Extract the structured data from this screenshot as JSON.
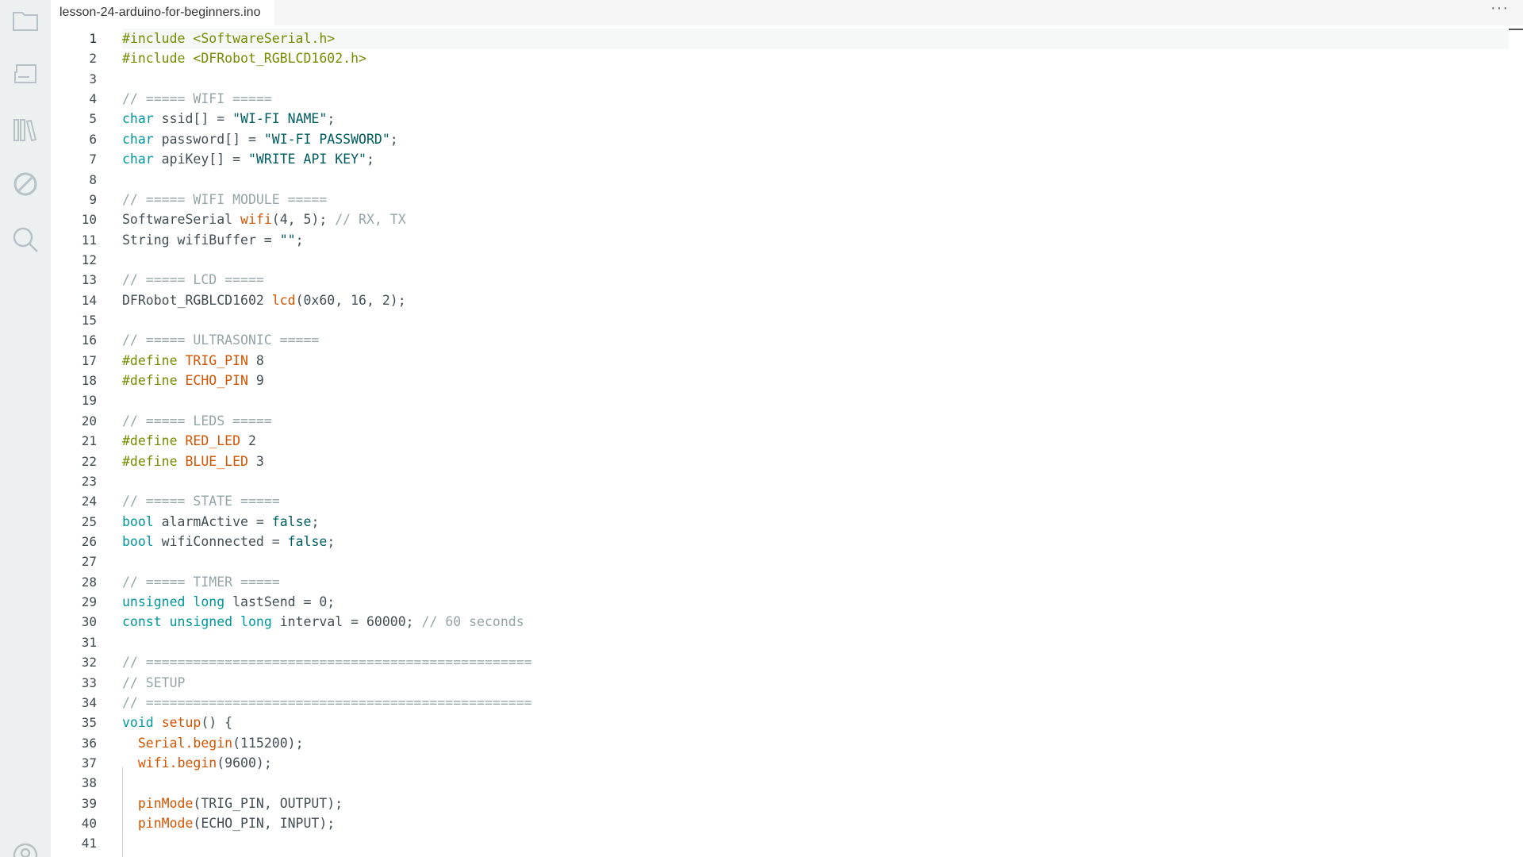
{
  "tab": {
    "filename": "lesson-24-arduino-for-beginners.ino",
    "more_label": "···"
  },
  "sidebar": {
    "icons": [
      "folder-icon",
      "board-icon",
      "library-icon",
      "debug-icon",
      "search-icon",
      "account-icon"
    ]
  },
  "editor": {
    "current_line": 1,
    "lines": [
      [
        [
          "pp",
          "#include <SoftwareSerial.h>"
        ]
      ],
      [
        [
          "pp",
          "#include <DFRobot_RGBLCD1602.h>"
        ]
      ],
      [],
      [
        [
          "com",
          "// ===== WIFI ====="
        ]
      ],
      [
        [
          "kw",
          "char"
        ],
        [
          "id",
          " ssid[] = "
        ],
        [
          "str",
          "\"WI-FI NAME\""
        ],
        [
          "id",
          ";"
        ]
      ],
      [
        [
          "kw",
          "char"
        ],
        [
          "id",
          " password[] = "
        ],
        [
          "str",
          "\"WI-FI PASSWORD\""
        ],
        [
          "id",
          ";"
        ]
      ],
      [
        [
          "kw",
          "char"
        ],
        [
          "id",
          " apiKey[] = "
        ],
        [
          "str",
          "\"WRITE API KEY\""
        ],
        [
          "id",
          ";"
        ]
      ],
      [],
      [
        [
          "com",
          "// ===== WIFI MODULE ====="
        ]
      ],
      [
        [
          "id",
          "SoftwareSerial "
        ],
        [
          "fn",
          "wifi"
        ],
        [
          "id",
          "(4, 5); "
        ],
        [
          "com",
          "// RX, TX"
        ]
      ],
      [
        [
          "id",
          "String wifiBuffer = "
        ],
        [
          "str",
          "\"\""
        ],
        [
          "id",
          ";"
        ]
      ],
      [],
      [
        [
          "com",
          "// ===== LCD ====="
        ]
      ],
      [
        [
          "id",
          "DFRobot_RGBLCD1602 "
        ],
        [
          "fn",
          "lcd"
        ],
        [
          "id",
          "(0x60, 16, 2);"
        ]
      ],
      [],
      [
        [
          "com",
          "// ===== ULTRASONIC ====="
        ]
      ],
      [
        [
          "pp",
          "#define "
        ],
        [
          "fn",
          "TRIG_PIN"
        ],
        [
          "id",
          " 8"
        ]
      ],
      [
        [
          "pp",
          "#define "
        ],
        [
          "fn",
          "ECHO_PIN"
        ],
        [
          "id",
          " 9"
        ]
      ],
      [],
      [
        [
          "com",
          "// ===== LEDS ====="
        ]
      ],
      [
        [
          "pp",
          "#define "
        ],
        [
          "fn",
          "RED_LED"
        ],
        [
          "id",
          " 2"
        ]
      ],
      [
        [
          "pp",
          "#define "
        ],
        [
          "fn",
          "BLUE_LED"
        ],
        [
          "id",
          " 3"
        ]
      ],
      [],
      [
        [
          "com",
          "// ===== STATE ====="
        ]
      ],
      [
        [
          "kw",
          "bool"
        ],
        [
          "id",
          " alarmActive = "
        ],
        [
          "num",
          "false"
        ],
        [
          "id",
          ";"
        ]
      ],
      [
        [
          "kw",
          "bool"
        ],
        [
          "id",
          " wifiConnected = "
        ],
        [
          "num",
          "false"
        ],
        [
          "id",
          ";"
        ]
      ],
      [],
      [
        [
          "com",
          "// ===== TIMER ====="
        ]
      ],
      [
        [
          "kw",
          "unsigned"
        ],
        [
          "id",
          " "
        ],
        [
          "kw",
          "long"
        ],
        [
          "id",
          " lastSend = 0;"
        ]
      ],
      [
        [
          "kw",
          "const"
        ],
        [
          "id",
          " "
        ],
        [
          "kw",
          "unsigned"
        ],
        [
          "id",
          " "
        ],
        [
          "kw",
          "long"
        ],
        [
          "id",
          " interval = 60000; "
        ],
        [
          "com",
          "// 60 seconds"
        ]
      ],
      [],
      [
        [
          "com",
          "// ================================================="
        ]
      ],
      [
        [
          "com",
          "// SETUP"
        ]
      ],
      [
        [
          "com",
          "// ================================================="
        ]
      ],
      [
        [
          "kw",
          "void"
        ],
        [
          "id",
          " "
        ],
        [
          "fn",
          "setup"
        ],
        [
          "id",
          "() {"
        ]
      ],
      [
        [
          "id",
          "  "
        ],
        [
          "fn",
          "Serial"
        ],
        [
          "fn",
          "."
        ],
        [
          "fn",
          "begin"
        ],
        [
          "id",
          "(115200);"
        ]
      ],
      [
        [
          "id",
          "  "
        ],
        [
          "fn",
          "wifi"
        ],
        [
          "fn",
          "."
        ],
        [
          "fn",
          "begin"
        ],
        [
          "id",
          "(9600);"
        ]
      ],
      [],
      [
        [
          "id",
          "  "
        ],
        [
          "fn",
          "pinMode"
        ],
        [
          "id",
          "(TRIG_PIN, OUTPUT);"
        ]
      ],
      [
        [
          "id",
          "  "
        ],
        [
          "fn",
          "pinMode"
        ],
        [
          "id",
          "(ECHO_PIN, INPUT);"
        ]
      ],
      []
    ]
  }
}
